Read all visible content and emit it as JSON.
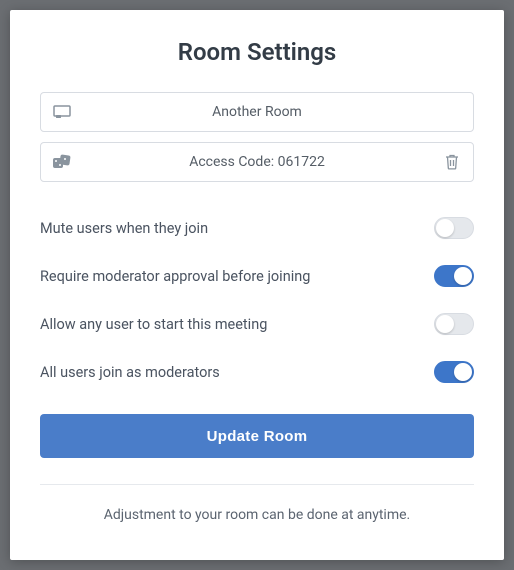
{
  "title": "Room Settings",
  "room_name": "Another Room",
  "access_code_label": "Access Code: 061722",
  "settings": [
    {
      "label": "Mute users when they join",
      "on": false
    },
    {
      "label": "Require moderator approval before joining",
      "on": true
    },
    {
      "label": "Allow any user to start this meeting",
      "on": false
    },
    {
      "label": "All users join as moderators",
      "on": true
    }
  ],
  "update_label": "Update Room",
  "footnote": "Adjustment to your room can be done at anytime."
}
